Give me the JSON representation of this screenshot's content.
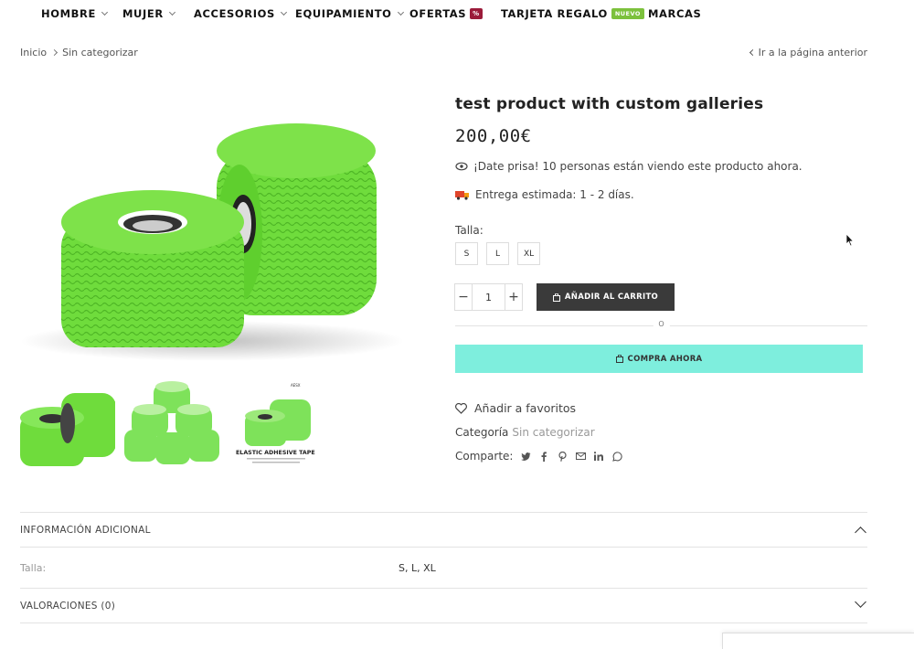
{
  "nav": {
    "items": [
      {
        "label": "HOMBRE"
      },
      {
        "label": "MUJER"
      },
      {
        "label": "ACCESORIOS"
      },
      {
        "label": "EQUIPAMIENTO"
      },
      {
        "label": "OFERTAS",
        "badge": "%"
      },
      {
        "label": "TARJETA REGALO",
        "badge": "NUEVO"
      },
      {
        "label": "MARCAS"
      }
    ]
  },
  "breadcrumb": {
    "home": "Inicio",
    "category": "Sin categorizar"
  },
  "back_link": "Ir a la página anterior",
  "product": {
    "title": "test product with custom galleries",
    "price": "200,00€",
    "viewers": "¡Date prisa! 10 personas están viendo este producto ahora.",
    "delivery": "Entrega estimada: 1 - 2 días.",
    "size_label": "Talla:",
    "sizes": [
      "S",
      "L",
      "XL"
    ],
    "quantity": "1",
    "add_to_cart": "AÑADIR AL CARRITO",
    "divider_text": "O",
    "buy_now": "COMPRA AHORA",
    "favorites": "Añadir a favoritos",
    "category_label": "Categoría",
    "category_value": "Sin categorizar",
    "share_label": "Comparte:",
    "thumb3_text": "ELASTIC ADHESIVE TAPE"
  },
  "accordion": {
    "info_title": "INFORMACIÓN ADICIONAL",
    "talla_label": "Talla:",
    "talla_value": "S, L, XL",
    "reviews_title": "VALORACIONES (0)"
  },
  "colors": {
    "accent": "#7eeedd",
    "dark_button": "#3a3a3a",
    "tape_green": "#6fdc3c"
  }
}
